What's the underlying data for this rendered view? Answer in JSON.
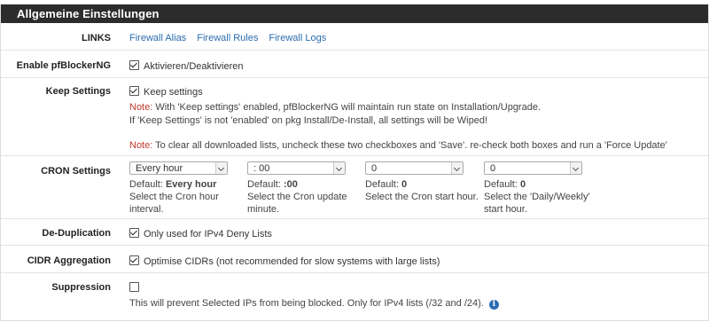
{
  "panel": {
    "title": "Allgemeine Einstellungen"
  },
  "links": {
    "label": "LINKS",
    "items": [
      "Firewall Alias",
      "Firewall Rules",
      "Firewall Logs"
    ]
  },
  "enable": {
    "label": "Enable pfBlockerNG",
    "checkbox_label": "Aktivieren/Deaktivieren",
    "checked": true
  },
  "keep": {
    "label": "Keep Settings",
    "checkbox_label": "Keep settings",
    "checked": true,
    "note1_prefix": "Note:",
    "note1_text": " With 'Keep settings' enabled, pfBlockerNG will maintain run state on Installation/Upgrade.",
    "note1_line2": "If 'Keep Settings' is not 'enabled' on pkg Install/De-Install, all settings will be Wiped!",
    "note2_prefix": "Note:",
    "note2_text": " To clear all downloaded lists, uncheck these two checkboxes and 'Save'. re-check both boxes and run a 'Force Update'"
  },
  "cron": {
    "label": "CRON Settings",
    "selects": [
      {
        "value": "Every hour",
        "default_prefix": "Default: ",
        "default_value": "Every hour",
        "help1": "Select the Cron hour",
        "help2": "interval."
      },
      {
        "value": ": 00",
        "default_prefix": "Default: ",
        "default_value": ":00",
        "help1": "Select the Cron update",
        "help2": "minute."
      },
      {
        "value": "0",
        "default_prefix": "Default: ",
        "default_value": "0",
        "help1": "Select the Cron start hour.",
        "help2": ""
      },
      {
        "value": "0",
        "default_prefix": "Default: ",
        "default_value": "0",
        "help1": "Select the 'Daily/Weekly'",
        "help2": "start hour."
      }
    ]
  },
  "dedup": {
    "label": "De-Duplication",
    "checkbox_label": "Only used for IPv4 Deny Lists",
    "checked": true
  },
  "cidr": {
    "label": "CIDR Aggregation",
    "checkbox_label": "Optimise CIDRs (not recommended for slow systems with large lists)",
    "checked": true
  },
  "suppression": {
    "label": "Suppression",
    "checked": false,
    "help": "This will prevent Selected IPs from being blocked. Only for IPv4 lists (/32 and /24)."
  },
  "colors": {
    "header_bg": "#2c2c2c",
    "link": "#2b6cb0",
    "note": "#c0392b"
  }
}
